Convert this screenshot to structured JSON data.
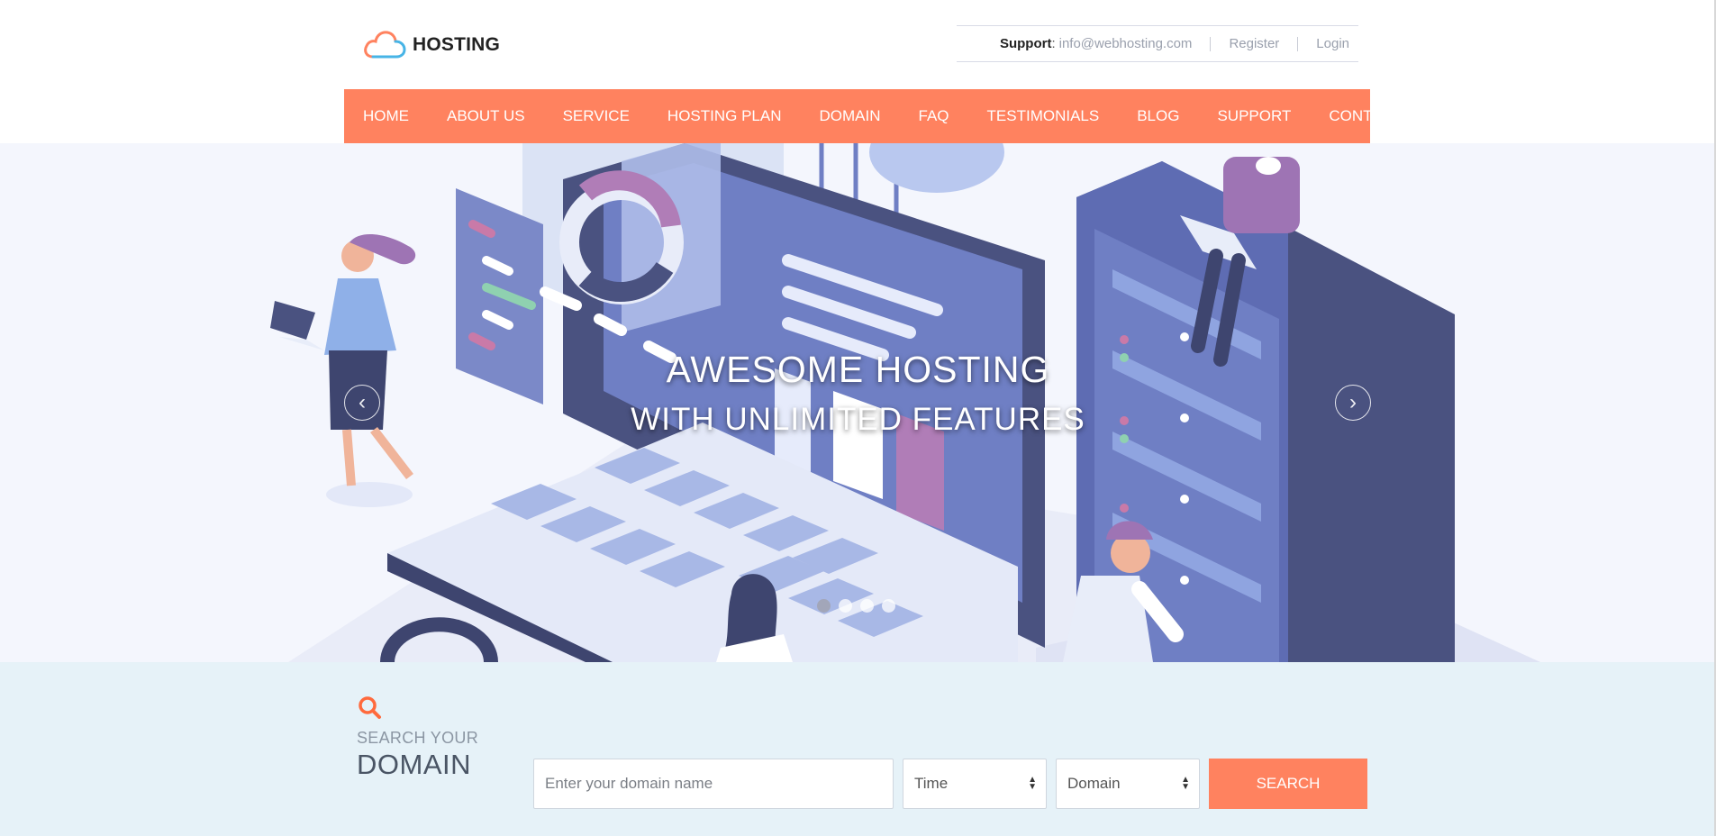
{
  "header": {
    "logo_text": "HOSTING",
    "logo_icon": "cloud-icon",
    "support_label": "Support",
    "support_separator": ":",
    "support_email": "info@webhosting.com",
    "register_label": "Register",
    "login_label": "Login"
  },
  "nav": {
    "items": [
      {
        "label": "HOME"
      },
      {
        "label": "ABOUT US"
      },
      {
        "label": "SERVICE"
      },
      {
        "label": "HOSTING PLAN"
      },
      {
        "label": "DOMAIN"
      },
      {
        "label": "FAQ"
      },
      {
        "label": "TESTIMONIALS"
      },
      {
        "label": "BLOG"
      },
      {
        "label": "SUPPORT"
      },
      {
        "label": "CONTACT US"
      }
    ]
  },
  "hero": {
    "title_line1": "AWESOME HOSTING",
    "title_line2": "WITH UNLIMITED FEATURES",
    "prev_icon": "‹",
    "next_icon": "›",
    "slide_count": 4,
    "active_slide": 1
  },
  "domain_search": {
    "icon": "search-icon",
    "label_small": "SEARCH YOUR",
    "label_big": "DOMAIN",
    "input_placeholder": "Enter your domain name",
    "select_time_value": "Time",
    "select_domain_value": "Domain",
    "button_label": "SEARCH"
  },
  "colors": {
    "accent": "#ff825f",
    "search_band": "#e6f2f8",
    "illustration_primary": "#6f7fc4",
    "illustration_dark": "#4a5280"
  }
}
